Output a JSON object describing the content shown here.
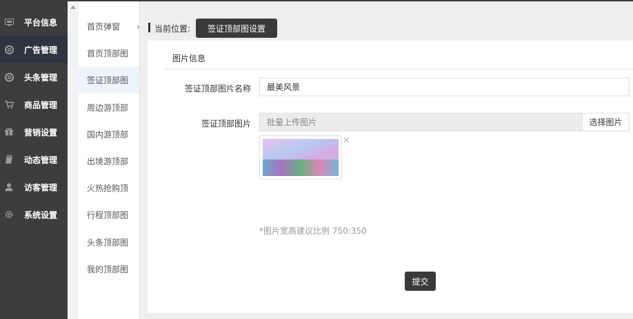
{
  "nav": {
    "items": [
      {
        "label": "平台信息",
        "icon": "monitor-icon"
      },
      {
        "label": "广告管理",
        "icon": "lifebuoy-icon",
        "active": true
      },
      {
        "label": "头条管理",
        "icon": "lifebuoy-icon"
      },
      {
        "label": "商品管理",
        "icon": "cart-icon"
      },
      {
        "label": "营销设置",
        "icon": "gift-icon"
      },
      {
        "label": "动态管理",
        "icon": "book-icon"
      },
      {
        "label": "访客管理",
        "icon": "user-icon"
      },
      {
        "label": "系统设置",
        "icon": "gear-icon"
      }
    ]
  },
  "submenu": {
    "items": [
      {
        "label": "首页弹窗",
        "chevron": "›"
      },
      {
        "label": "首页顶部图"
      },
      {
        "label": "签证顶部图",
        "active": true
      },
      {
        "label": "周边游顶部"
      },
      {
        "label": "国内游顶部"
      },
      {
        "label": "出境游顶部"
      },
      {
        "label": "火热抢购顶"
      },
      {
        "label": "行程顶部图"
      },
      {
        "label": "头条顶部图"
      },
      {
        "label": "我的顶部图"
      }
    ]
  },
  "breadcrumb": {
    "label": "当前位置:",
    "current": "签证顶部图设置"
  },
  "panel": {
    "title": "图片信息",
    "name_label": "签证顶部图片名称",
    "name_value": "最美风景",
    "image_label": "签证顶部图片",
    "upload_placeholder": "批量上传图片",
    "choose_label": "选择图片",
    "remove_glyph": "×",
    "hint": "*图片宽高建议比例 750:350",
    "submit_label": "提交"
  },
  "colors": {
    "nav_bg": "#3d3d3d",
    "nav_active": "#2e3540",
    "button_dark": "#3a3a3a"
  }
}
